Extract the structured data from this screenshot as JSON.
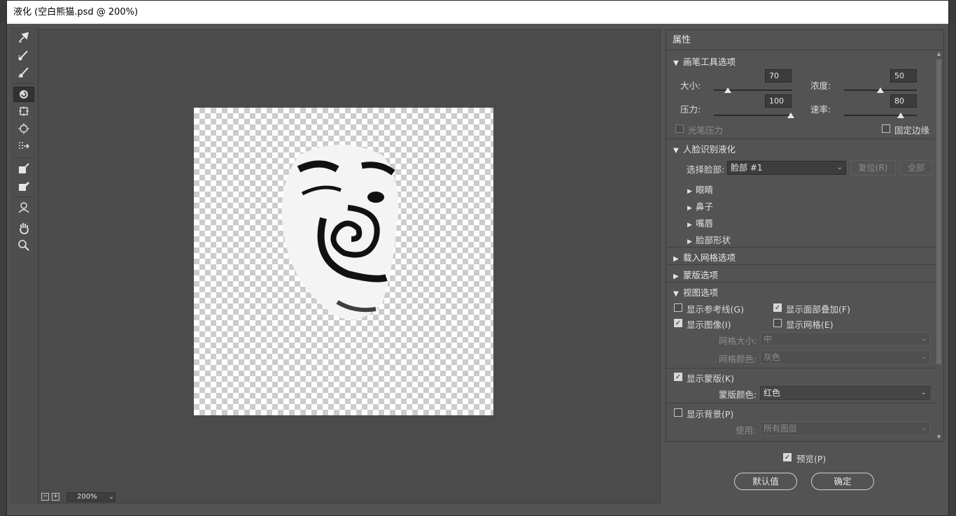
{
  "window": {
    "title": "液化 (空白熊猫.psd @ 200%)"
  },
  "canvas": {
    "zoom_value": "200%",
    "zoom_out_symbol": "−",
    "zoom_in_symbol": "+",
    "zoom_dropdown_symbol": "⌄"
  },
  "panel": {
    "title": "属性",
    "brush_section": {
      "title": "画笔工具选项",
      "size_label": "大小:",
      "size_value": "70",
      "size_fraction": 0.17,
      "density_label": "浓度:",
      "density_value": "50",
      "density_fraction": 0.5,
      "pressure_label": "压力:",
      "pressure_value": "100",
      "pressure_fraction": 1.0,
      "rate_label": "速率:",
      "rate_value": "80",
      "rate_fraction": 0.8,
      "stylus_label": "光笔压力",
      "stylus_checked": false,
      "pin_edges_label": "固定边缘",
      "pin_edges_checked": false
    },
    "face_section": {
      "title": "人脸识别液化",
      "select_face_label": "选择脸部:",
      "select_face_value": "脸部 #1",
      "reset_label": "复位(R)",
      "all_label": "全部",
      "subsections": [
        "眼睛",
        "鼻子",
        "嘴唇",
        "脸部形状"
      ]
    },
    "load_mesh_title": "载入网格选项",
    "mask_options_title": "蒙版选项",
    "view_section": {
      "title": "视图选项",
      "show_guides_label": "显示参考线(G)",
      "show_guides_checked": false,
      "show_face_overlay_label": "显示面部叠加(F)",
      "show_face_overlay_checked": true,
      "show_image_label": "显示图像(I)",
      "show_image_checked": true,
      "show_mesh_label": "显示网格(E)",
      "show_mesh_checked": false,
      "mesh_size_label": "网格大小:",
      "mesh_size_value": "中",
      "mesh_color_label": "网格颜色:",
      "mesh_color_value": "灰色",
      "show_mask_label": "显示蒙版(K)",
      "show_mask_checked": true,
      "mask_color_label": "蒙版颜色:",
      "mask_color_value": "红色",
      "show_backdrop_label": "显示背景(P)",
      "show_backdrop_checked": false,
      "use_label": "使用:",
      "use_value": "所有图层"
    }
  },
  "footer": {
    "preview_label": "预览(P)",
    "preview_checked": true,
    "default_label": "默认值",
    "ok_label": "确定"
  },
  "icons": {
    "check": "✓",
    "expanded": "▼",
    "collapsed": "▶",
    "dropdown": "⌄"
  }
}
